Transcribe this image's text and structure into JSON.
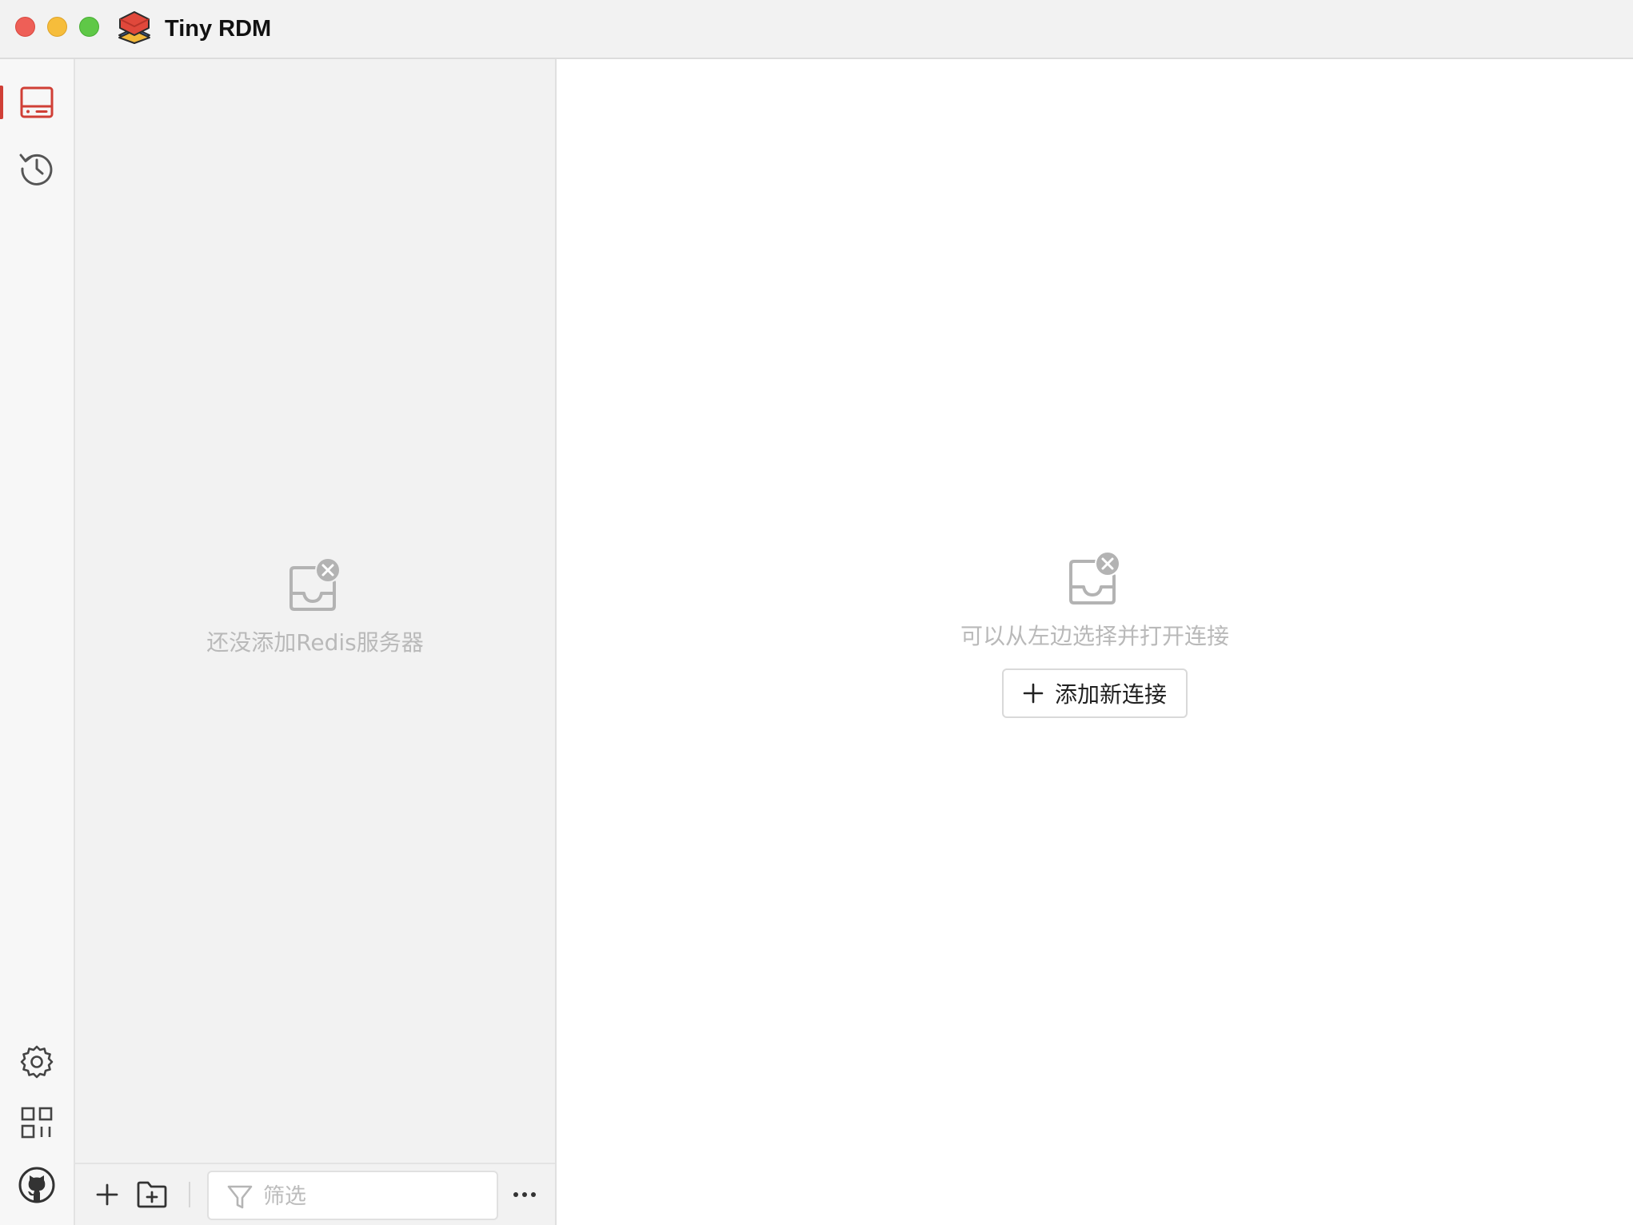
{
  "window": {
    "title": "Tiny RDM"
  },
  "activity_bar": {
    "top_items": [
      {
        "icon": "server-icon",
        "active": true
      },
      {
        "icon": "history-icon",
        "active": false
      }
    ],
    "bottom_items": [
      {
        "icon": "gear-icon"
      },
      {
        "icon": "apps-grid-icon"
      },
      {
        "icon": "github-icon"
      }
    ],
    "accent_color": "#d03f36"
  },
  "connection_panel": {
    "empty_text": "还没添加Redis服务器",
    "filter": {
      "placeholder": "筛选",
      "value": ""
    }
  },
  "main": {
    "empty_text": "可以从左边选择并打开连接",
    "add_button_label": "添加新连接"
  }
}
